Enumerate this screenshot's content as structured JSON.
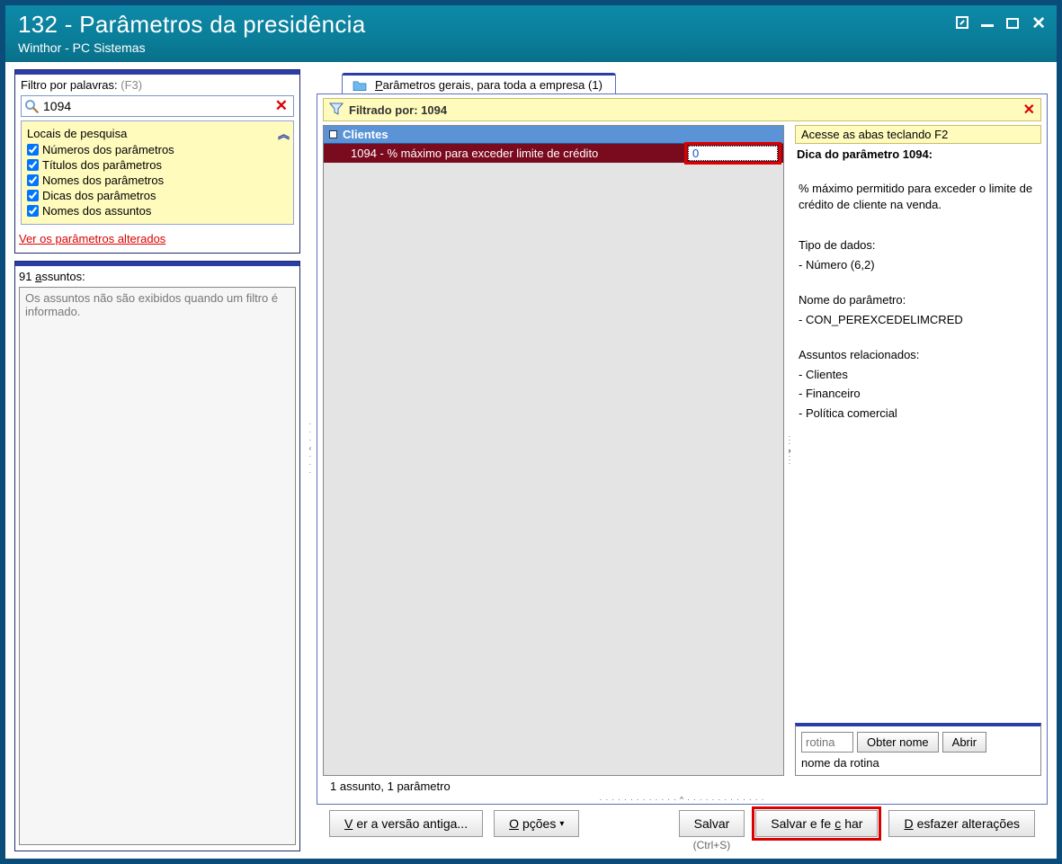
{
  "window": {
    "title": "132 - Parâmetros da presidência",
    "subtitle": "Winthor - PC Sistemas"
  },
  "filter": {
    "label": "Filtro por palavras:",
    "hint": "(F3)",
    "value": "1094",
    "places_header": "Locais de pesquisa",
    "options": {
      "numeros": "Números dos parâmetros",
      "titulos": "Títulos dos parâmetros",
      "nomes": "Nomes dos parâmetros",
      "dicas": "Dicas dos parâmetros",
      "assuntos": "Nomes dos assuntos"
    },
    "changed_link": "Ver os parâmetros alterados"
  },
  "assuntos": {
    "count_label_pre": "91 ",
    "count_label_u": "a",
    "count_label_post": "ssuntos:",
    "body": "Os assuntos não são exibidos quando um filtro é informado."
  },
  "tab": {
    "pre": "",
    "u": "P",
    "post": "arâmetros gerais, para toda a empresa  (1)"
  },
  "filterbar": {
    "text": "Filtrado por: 1094"
  },
  "tree": {
    "group": "Clientes",
    "param_text": "1094 - % máximo para exceder limite de crédito",
    "param_value": "0"
  },
  "right": {
    "tip": "Acesse as abas teclando F2",
    "title": "Dica do parâmetro 1094:",
    "desc": "% máximo permitido para exceder o limite de crédito de cliente na venda.",
    "tipo_label": "Tipo de dados:",
    "tipo_value": "- Número (6,2)",
    "nome_label": "Nome do parâmetro:",
    "nome_value": "- CON_PEREXCEDELIMCRED",
    "rel_label": "Assuntos relacionados:",
    "rel1": "- Clientes",
    "rel2": "- Financeiro",
    "rel3": "- Política comercial",
    "rotina_placeholder": "rotina",
    "obter": "Obter nome",
    "abrir": "Abrir",
    "nome_rotina": "nome da rotina"
  },
  "status": "1 assunto, 1 parâmetro",
  "buttons": {
    "old_u": "V",
    "old_post": "er a versão antiga...",
    "opt_u": "O",
    "opt_post": "pções",
    "salvar": "Salvar",
    "fechar_pre": "Salvar e fe",
    "fechar_u": "c",
    "fechar_post": "har",
    "desfazer_u": "D",
    "desfazer_post": "esfazer alterações",
    "shortcut": "(Ctrl+S)"
  }
}
